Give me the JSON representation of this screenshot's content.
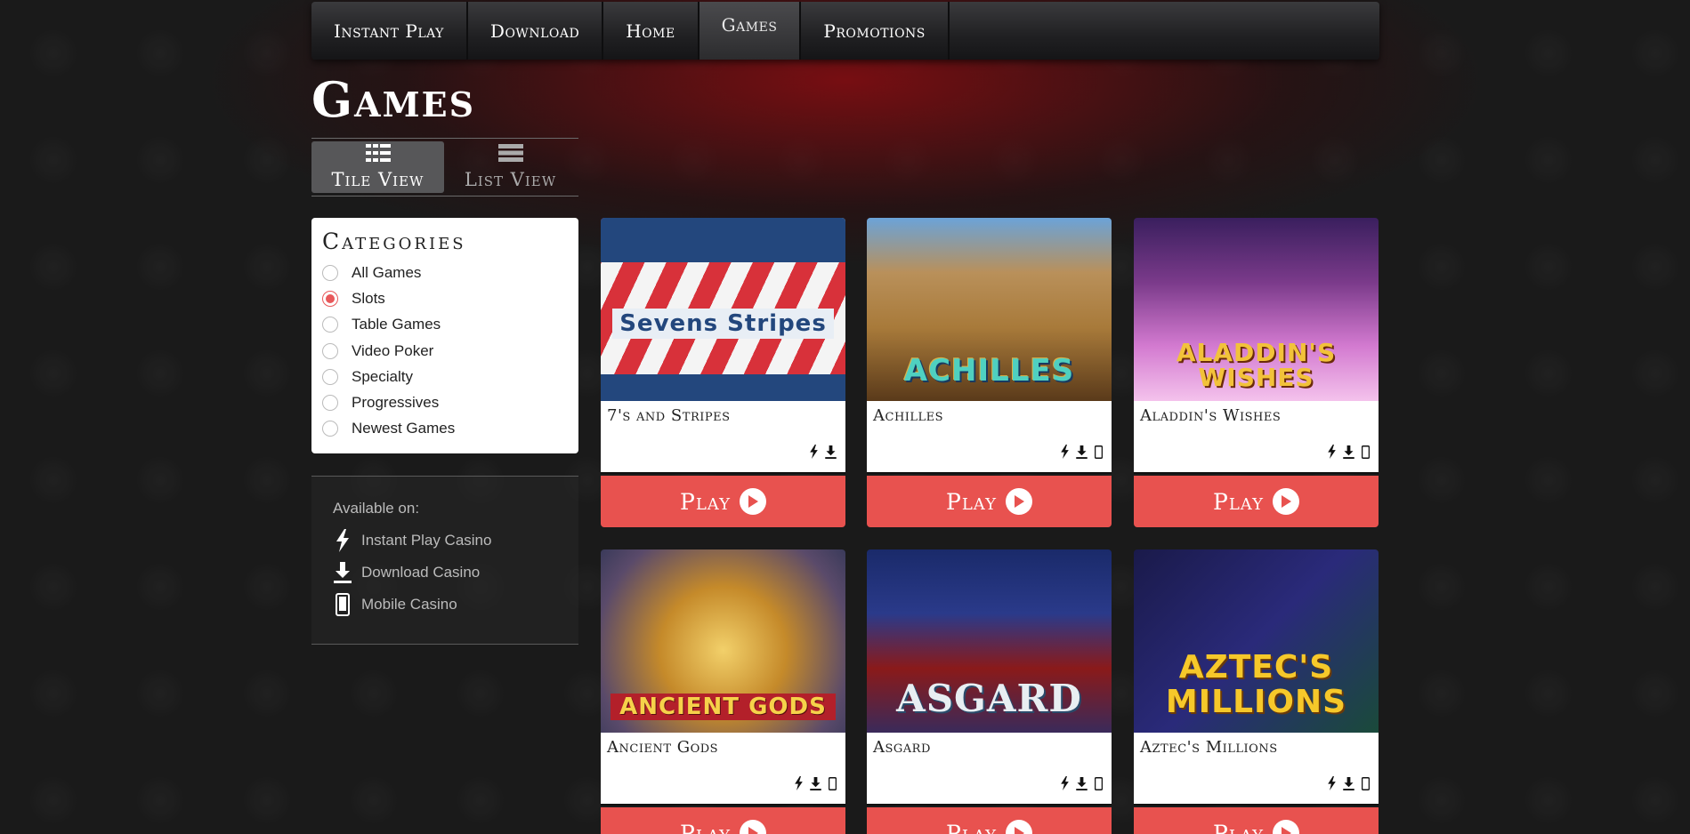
{
  "nav": {
    "items": [
      {
        "label": "Instant Play"
      },
      {
        "label": "Download"
      },
      {
        "label": "Home"
      },
      {
        "label": "Games"
      },
      {
        "label": "Promotions"
      }
    ],
    "active_index": 3
  },
  "page": {
    "title": "Games"
  },
  "view_toggle": {
    "tile_label": "Tile View",
    "list_label": "List View",
    "active": "tile"
  },
  "categories": {
    "title": "Categories",
    "items": [
      {
        "label": "All Games",
        "checked": false
      },
      {
        "label": "Slots",
        "checked": true
      },
      {
        "label": "Table Games",
        "checked": false
      },
      {
        "label": "Video Poker",
        "checked": false
      },
      {
        "label": "Specialty",
        "checked": false
      },
      {
        "label": "Progressives",
        "checked": false
      },
      {
        "label": "Newest Games",
        "checked": false
      }
    ],
    "accent_color": "#e8585a"
  },
  "availability": {
    "title": "Available on:",
    "items": [
      {
        "label": "Instant Play Casino",
        "icon": "lightning-icon"
      },
      {
        "label": "Download Casino",
        "icon": "download-icon"
      },
      {
        "label": "Mobile Casino",
        "icon": "mobile-icon"
      }
    ]
  },
  "games": [
    {
      "name": "7's and Stripes",
      "art_text": "Sevens Stripes",
      "icons": [
        "lightning-icon",
        "download-icon"
      ]
    },
    {
      "name": "Achilles",
      "art_text": "ACHILLES",
      "icons": [
        "lightning-icon",
        "download-icon",
        "mobile-icon"
      ]
    },
    {
      "name": "Aladdin's Wishes",
      "art_text": "ALADDIN'S WISHES",
      "icons": [
        "lightning-icon",
        "download-icon",
        "mobile-icon"
      ]
    },
    {
      "name": "Ancient Gods",
      "art_text": "ANCIENT GODS",
      "icons": [
        "lightning-icon",
        "download-icon",
        "mobile-icon"
      ]
    },
    {
      "name": "Asgard",
      "art_text": "ASGARD",
      "icons": [
        "lightning-icon",
        "download-icon",
        "mobile-icon"
      ]
    },
    {
      "name": "Aztec's Millions",
      "art_text": "AZTEC'S MILLIONS",
      "icons": [
        "lightning-icon",
        "download-icon",
        "mobile-icon"
      ]
    }
  ],
  "play_label": "Play",
  "colors": {
    "play_button": "#e8524f",
    "card_bg": "#ffffff"
  }
}
